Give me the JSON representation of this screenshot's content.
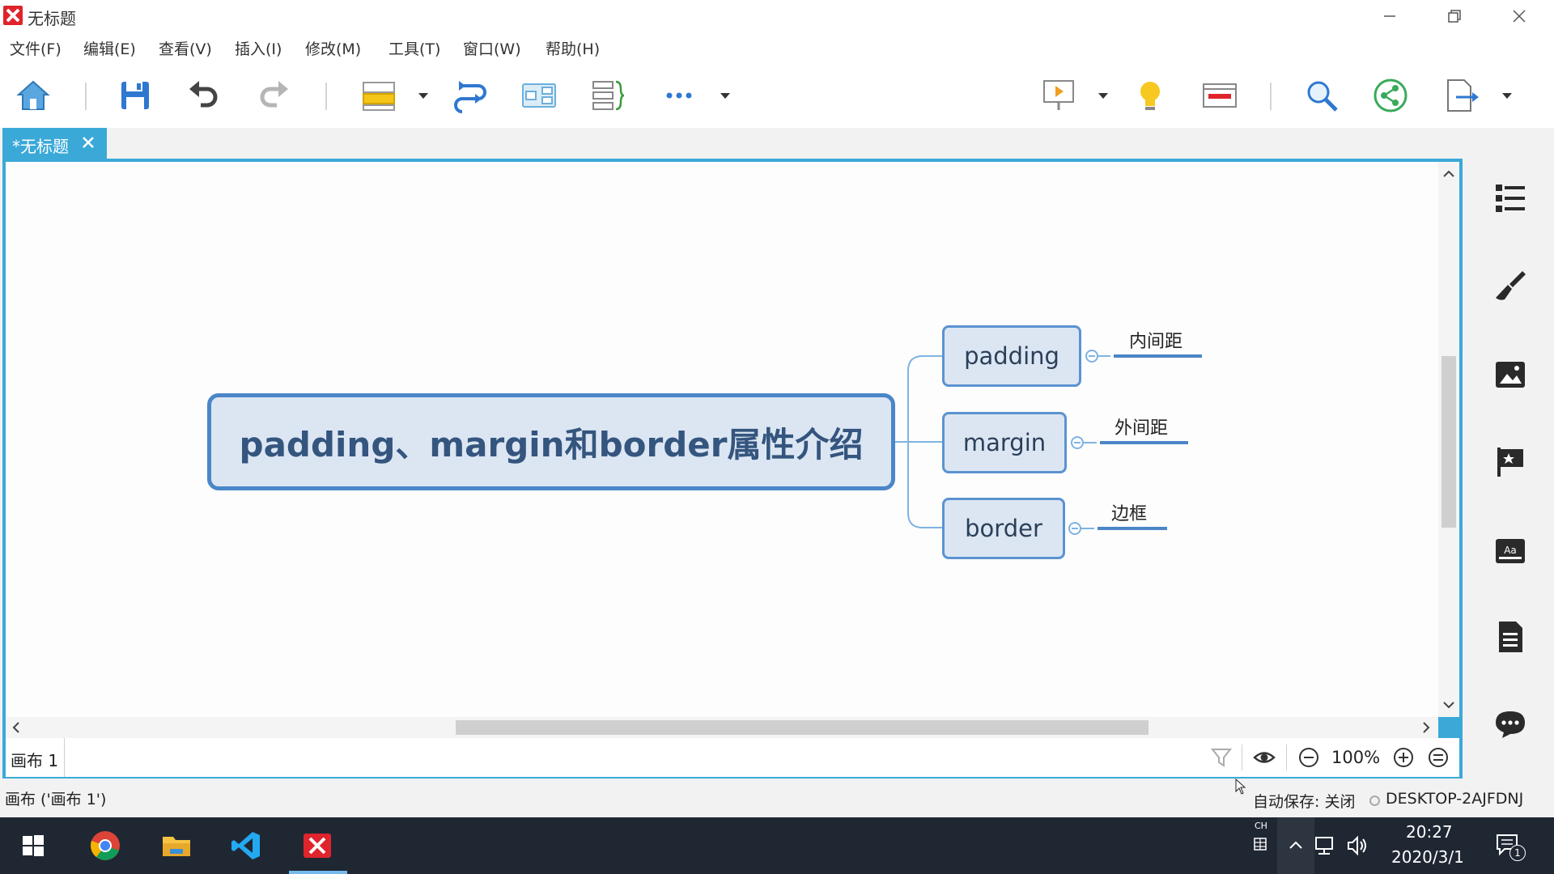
{
  "window": {
    "title": "无标题",
    "minimize_icon": "minimize-icon",
    "restore_icon": "restore-icon",
    "close_icon": "close-icon"
  },
  "menu": [
    "文件(F)",
    "编辑(E)",
    "查看(V)",
    "插入(I)",
    "修改(M)",
    "工具(T)",
    "窗口(W)",
    "帮助(H)"
  ],
  "toolbar": {
    "icons": [
      "home-icon",
      "save-icon",
      "undo-icon",
      "redo-icon",
      "insert-topic-icon",
      "relationship-icon",
      "boundary-icon",
      "summary-icon",
      "more-icon",
      "presentation-icon",
      "brainstorm-icon",
      "gantt-icon",
      "search-icon",
      "share-icon",
      "export-icon"
    ]
  },
  "tab": {
    "label": "*无标题"
  },
  "mindmap": {
    "central_topic": "padding、margin和border属性介绍",
    "topics": [
      {
        "label": "padding",
        "subtopic": "内间距"
      },
      {
        "label": "margin",
        "subtopic": "外间距"
      },
      {
        "label": "border",
        "subtopic": "边框"
      }
    ]
  },
  "sheet_bar": {
    "sheet_tab": "画布 1",
    "zoom": "100%"
  },
  "status": {
    "left": "画布 ('画布 1')",
    "autosave": "自动保存: 关闭",
    "host": "DESKTOP-2AJFDNJ"
  },
  "taskbar": {
    "apps": [
      "windows-start-icon",
      "chrome-icon",
      "file-explorer-icon",
      "vscode-icon",
      "xmind-icon"
    ],
    "ime": "CH",
    "time": "20:27",
    "date": "2020/3/1",
    "notification_count": "1"
  },
  "right_panel": [
    "outline-icon",
    "format-icon",
    "image-icon",
    "marker-icon",
    "style-icon",
    "notes-icon",
    "comment-icon"
  ],
  "colors": {
    "accent": "#3ba9d8",
    "topic_fill": "#dce6f3",
    "topic_border": "#5b93d0",
    "central_text": "#34557e",
    "taskbar": "#1f2733"
  }
}
